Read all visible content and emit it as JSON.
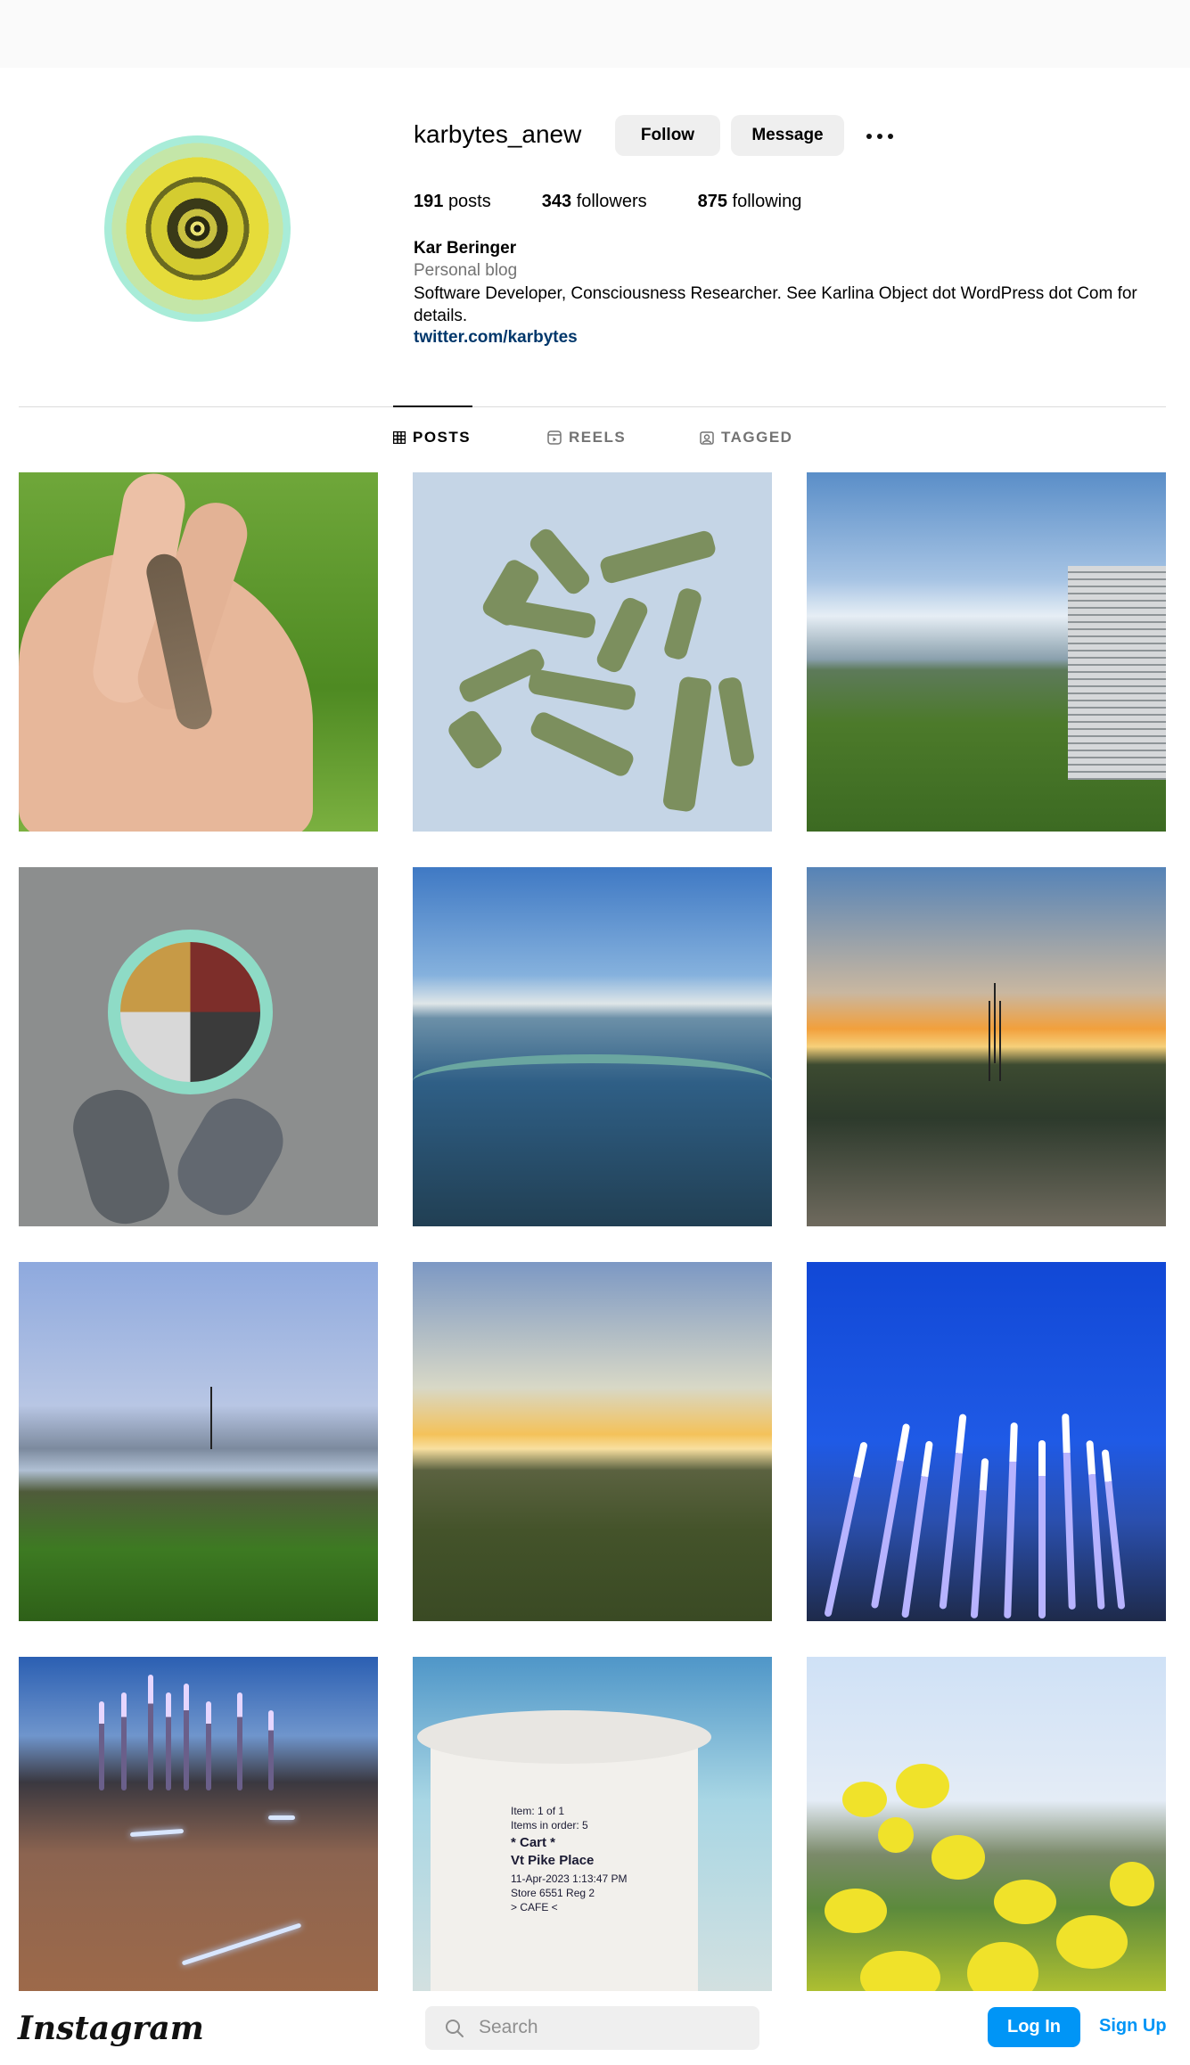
{
  "profile": {
    "username": "karbytes_anew",
    "follow_label": "Follow",
    "message_label": "Message",
    "more_icon": "more-horizontal-icon",
    "stats": {
      "posts_count": "191",
      "posts_label": "posts",
      "followers_count": "343",
      "followers_label": "followers",
      "following_count": "875",
      "following_label": "following"
    },
    "bio": {
      "name": "Kar Beringer",
      "category": "Personal blog",
      "text": "Software Developer, Consciousness Researcher. See Karlina Object dot WordPress dot Com for details.",
      "link": "twitter.com/karbytes"
    }
  },
  "tabs": {
    "posts": "POSTS",
    "reels": "REELS",
    "tagged": "TAGGED",
    "active": "posts"
  },
  "posts": {
    "count_shown": 12
  },
  "footer": {
    "brand": "Instagram",
    "search_placeholder": "Search",
    "login_label": "Log In",
    "signup_label": "Sign Up"
  },
  "colors": {
    "accent": "#0095f6",
    "link": "#00376b",
    "muted": "#737373",
    "button_bg": "#efefef"
  },
  "receipt": {
    "line1": "Item: 1 of 1",
    "line2": "Items in order: 5",
    "line3": "* Cart *",
    "line4": "Vt Pike Place",
    "line5": "11-Apr-2023   1:13:47 PM",
    "line6": "Store 6551  Reg 2",
    "line7": "> CAFE <"
  }
}
